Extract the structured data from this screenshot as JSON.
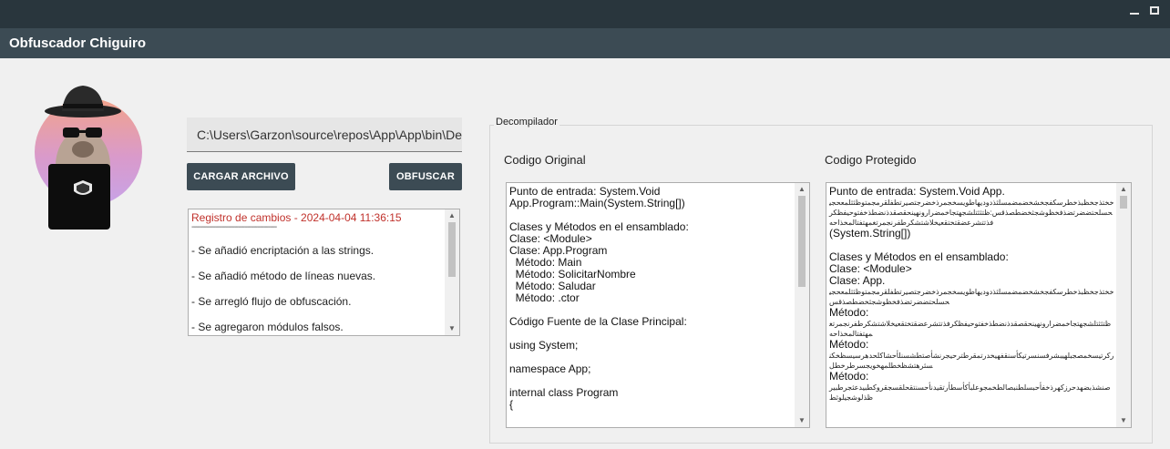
{
  "window": {
    "title": "Obfuscador Chiguiro",
    "minimize_glyph": "_",
    "maximize_glyph": "□"
  },
  "path": {
    "value": "C:\\Users\\Garzon\\source\\repos\\App\\App\\bin\\De"
  },
  "buttons": {
    "load": "CARGAR ARCHIVO",
    "obfuscate": "OBFUSCAR"
  },
  "log": {
    "title": "Registro de cambios - 2024-04-04 11:36:15",
    "separator": "----------------------------------------",
    "items": [
      "- Se añadió encriptación a las strings.",
      "- Se añadió método de líneas nuevas.",
      "- Se arregló flujo de obfuscación.",
      "- Se agregaron módulos falsos."
    ]
  },
  "decompiler": {
    "group_label": "Decompilador",
    "original_heading": "Codigo Original",
    "protected_heading": "Codigo Protegido",
    "original_lines": [
      "Punto de entrada: System.Void App.Program::Main(System.String[])",
      "",
      "Clases y Métodos en el ensamblado:",
      "Clase: <Module>",
      "Clase: App.Program",
      "  Método: Main",
      "  Método: SolicitarNombre",
      "  Método: Saludar",
      "  Método: .ctor",
      "",
      "Código Fuente de la Clase Principal:",
      "",
      "using System;",
      "",
      "namespace App;",
      "",
      "internal class Program",
      "{"
    ],
    "protected": {
      "entry_label": "Punto de entrada: System.Void App.",
      "entry_suffix": "(System.String[])",
      "classes_label": "Clases y Métodos en el ensamblado:",
      "class_module": "Clase: <Module>",
      "class_app": "Clase: App.",
      "method_label": " Método:"
    }
  },
  "colors": {
    "topbar": "#29363d",
    "titlebar": "#3c4b54",
    "button": "#3c4b54",
    "log_title": "#c0312b"
  }
}
